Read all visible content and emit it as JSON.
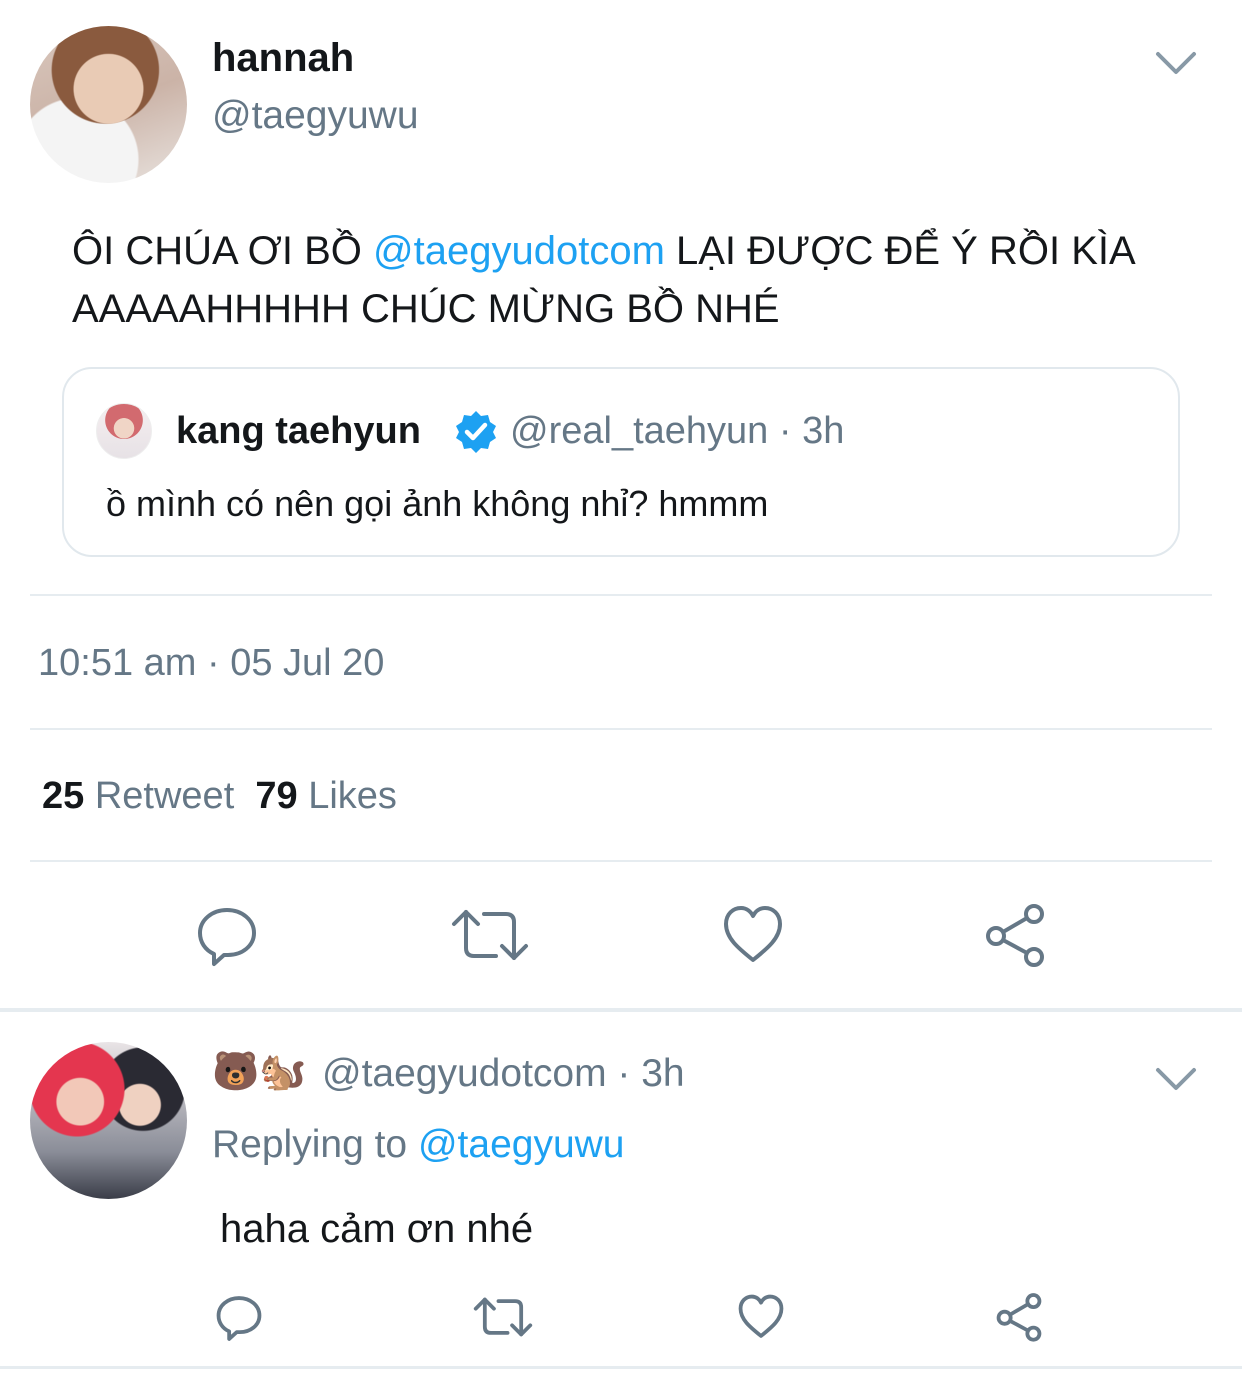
{
  "tweet": {
    "display_name": "hannah",
    "handle": "@taegyuwu",
    "text_before": "ÔI CHÚA ƠI BỒ ",
    "mention": "@taegyudotcom",
    "text_after": " LẠI ĐƯỢC ĐỂ Ý RỒI KÌA AAAAAHHHHH CHÚC MỪNG BỒ NHÉ",
    "timestamp": "10:51 am · 05 Jul 20",
    "retweet_count": "25",
    "retweet_label": "Retweet",
    "likes_count": "79",
    "likes_label": "Likes"
  },
  "quoted": {
    "display_name": "kang taehyun",
    "meta": "@real_taehyun · 3h",
    "text": "ồ mình có nên gọi ảnh không nhỉ? hmmm"
  },
  "reply": {
    "emoji": "🐻🐿️",
    "meta": "@taegyudotcom · 3h",
    "replying_prefix": "Replying to ",
    "replying_handle": "@taegyuwu",
    "text": "haha cảm ơn nhé"
  },
  "colors": {
    "link": "#1da1f2",
    "secondary_text": "#657786",
    "primary_text": "#14171a",
    "divider": "#e6ecf0"
  },
  "icons": [
    "chevron-down-icon",
    "verified-badge-icon",
    "reply-icon",
    "retweet-icon",
    "like-icon",
    "share-icon"
  ]
}
